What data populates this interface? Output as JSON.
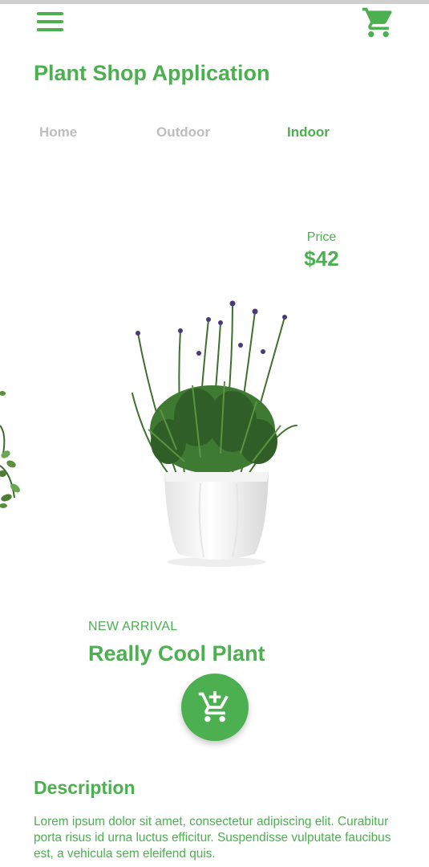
{
  "header": {
    "menu_icon": "hamburger-menu-icon",
    "cart_icon": "shopping-cart-icon",
    "title": "Plant Shop Application"
  },
  "tabs": [
    {
      "label": "Home",
      "active": false
    },
    {
      "label": "Outdoor",
      "active": false
    },
    {
      "label": "Indoor",
      "active": true
    }
  ],
  "product": {
    "price_label": "Price",
    "price": "$42",
    "tag": "NEW ARRIVAL",
    "name": "Really Cool Plant",
    "add_icon": "add-to-cart-icon"
  },
  "description": {
    "heading": "Description",
    "text": "Lorem ipsum dolor sit amet, consectetur adipiscing elit. Curabitur porta risus id urna luctus efficitur. Suspendisse vulputate faucibus est, a vehicula sem eleifend quis."
  },
  "colors": {
    "accent": "#4caf50",
    "inactive_tab": "#bdbdbd",
    "background": "#ffffff"
  }
}
